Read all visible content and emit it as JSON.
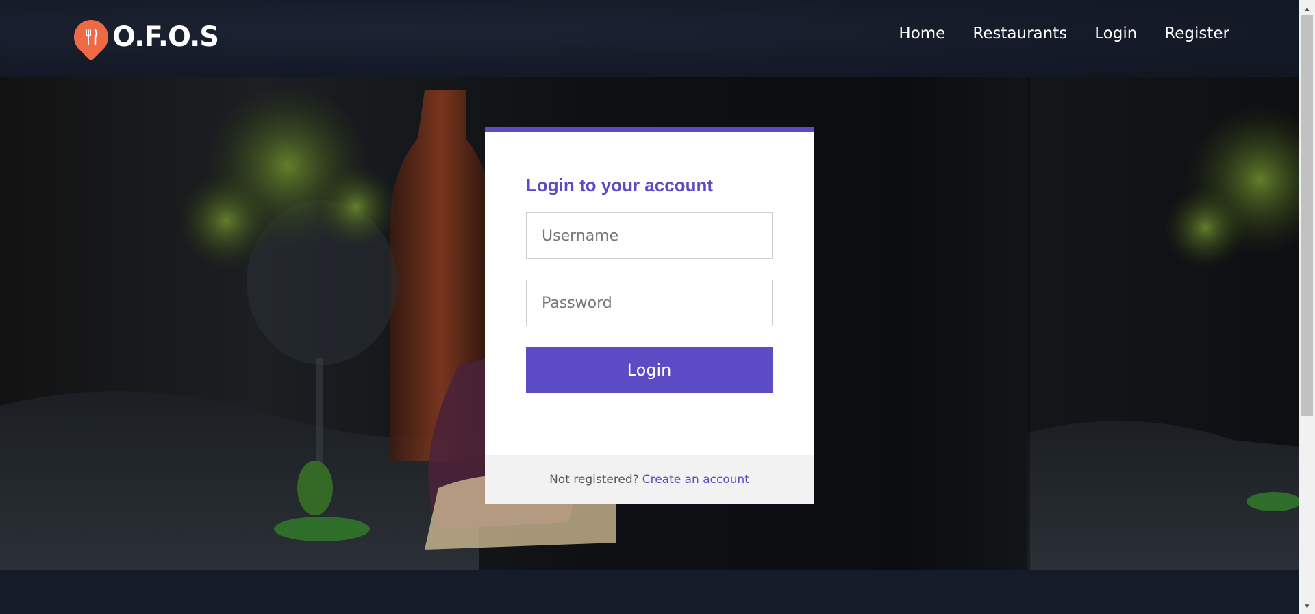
{
  "brand": {
    "name": "O.F.O.S",
    "accent": "#ee6a45"
  },
  "nav": {
    "items": [
      {
        "label": "Home"
      },
      {
        "label": "Restaurants"
      },
      {
        "label": "Login"
      },
      {
        "label": "Register"
      }
    ]
  },
  "login_card": {
    "title": "Login to your account",
    "username_placeholder": "Username",
    "username_value": "",
    "password_placeholder": "Password",
    "password_value": "",
    "submit_label": "Login",
    "footer_text": "Not registered?",
    "footer_link": "Create an account",
    "accent": "#5b4bc4"
  },
  "icons": {
    "logo": "fork-knife-pin-icon",
    "scroll_up": "triangle-up-icon",
    "scroll_down": "triangle-down-icon"
  }
}
